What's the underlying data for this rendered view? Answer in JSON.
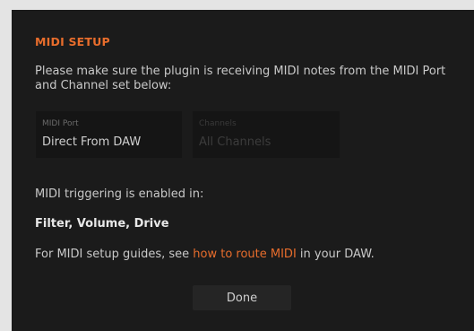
{
  "dialog": {
    "title": "MIDI SETUP",
    "description": "Please make sure the plugin is receiving MIDI notes from the MIDI Port and Channel set below:",
    "midi_port": {
      "label": "MIDI Port",
      "value": "Direct From DAW"
    },
    "channels": {
      "label": "Channels",
      "value": "All Channels",
      "disabled": true
    },
    "triggering_text": "MIDI triggering is enabled in:",
    "triggering_params": "Filter, Volume, Drive",
    "guide": {
      "prefix": "For MIDI setup guides, see ",
      "link_text": "how to route MIDI",
      "suffix": " in your DAW."
    },
    "done_label": "Done"
  },
  "colors": {
    "accent": "#e86d2c",
    "background": "#1b1b1b",
    "field_background": "#151515"
  }
}
